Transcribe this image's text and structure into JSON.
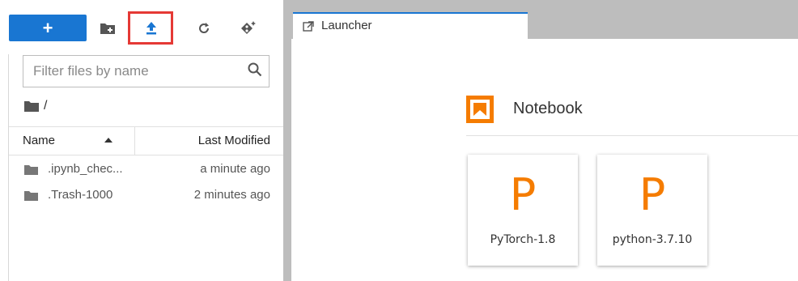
{
  "toolbar": {
    "new_label": "+",
    "buttons": [
      "new-folder-icon",
      "upload-icon",
      "refresh-icon",
      "git-clone-icon"
    ],
    "highlight_color": "#e53935",
    "accent": "#1976d2"
  },
  "filebrowser": {
    "filter_placeholder": "Filter files by name",
    "breadcrumb": "/",
    "columns": {
      "name": "Name",
      "modified": "Last Modified"
    },
    "files": [
      {
        "name": ".ipynb_chec...",
        "modified": "a minute ago"
      },
      {
        "name": ".Trash-1000",
        "modified": "2 minutes ago"
      }
    ]
  },
  "tabs": [
    {
      "label": "Launcher"
    }
  ],
  "launcher": {
    "section_title": "Notebook",
    "kernels": [
      {
        "letter": "P",
        "label": "PyTorch-1.8"
      },
      {
        "letter": "P",
        "label": "python-3.7.10"
      }
    ],
    "brand_color": "#f57c00"
  }
}
